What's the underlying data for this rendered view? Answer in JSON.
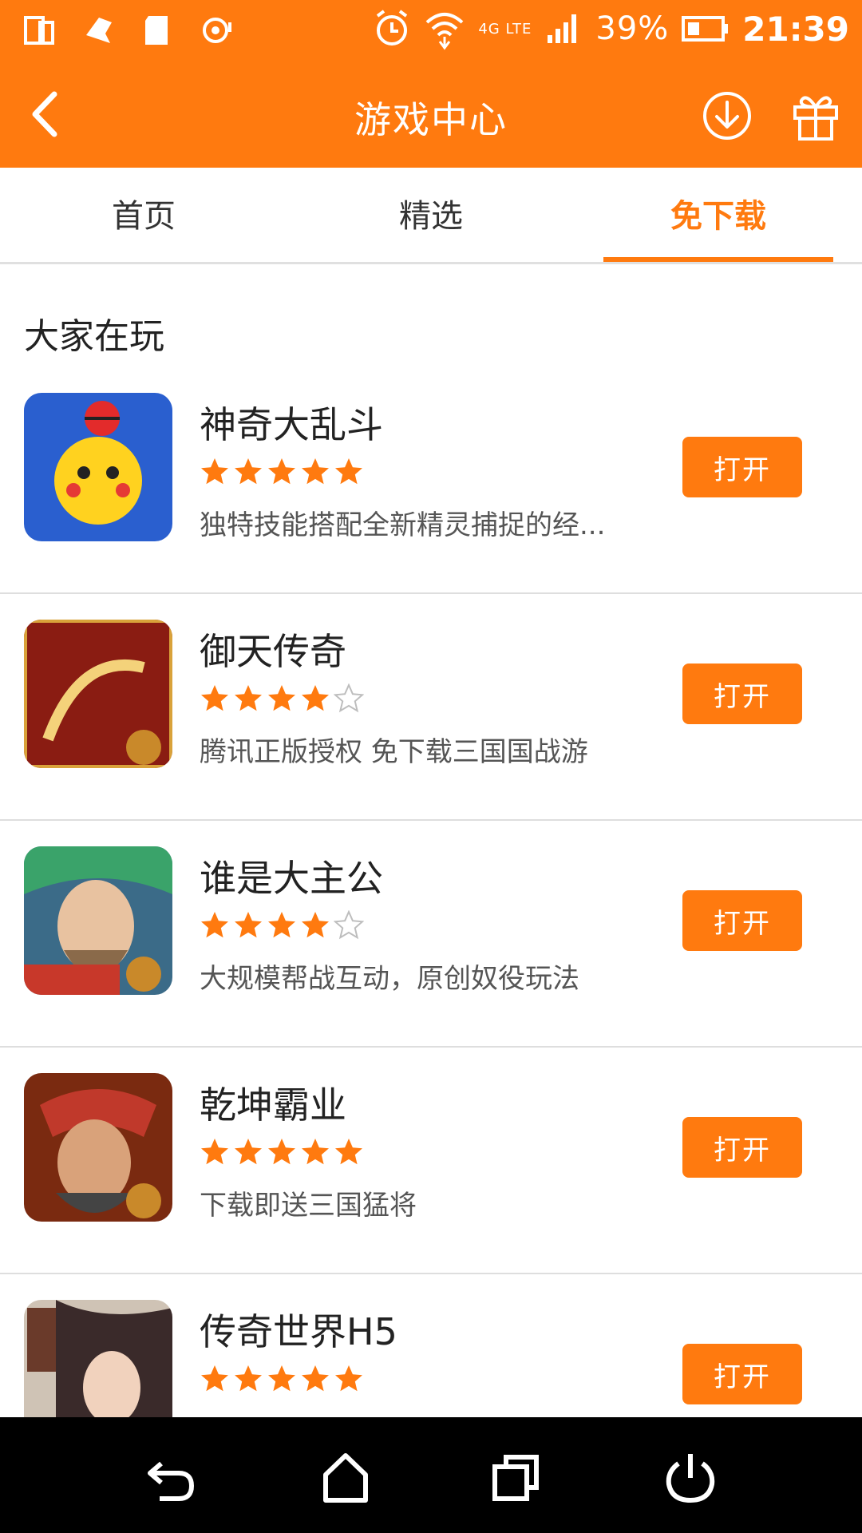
{
  "status_bar": {
    "battery": "39%",
    "time": "21:39",
    "network": "4G LTE",
    "icons": [
      "screen-icon",
      "notification-icon",
      "sd-card-icon",
      "sync-icon",
      "alarm-icon",
      "wifi-icon",
      "signal-icon",
      "battery-icon"
    ]
  },
  "app_bar": {
    "title": "游戏中心",
    "back_icon": "chevron-left-icon",
    "download_icon": "download-icon",
    "gift_icon": "gift-icon"
  },
  "tabs": [
    {
      "label": "首页",
      "active": false
    },
    {
      "label": "精选",
      "active": false
    },
    {
      "label": "免下载",
      "active": true
    }
  ],
  "section": {
    "title": "大家在玩"
  },
  "games": [
    {
      "name": "神奇大乱斗",
      "rating": 5,
      "desc": "独特技能搭配全新精灵捕捉的经...",
      "button": "打开",
      "icon_color": "#2a5fcf"
    },
    {
      "name": "御天传奇",
      "rating": 4,
      "desc": "腾讯正版授权 免下载三国国战游",
      "button": "打开",
      "icon_color": "#8a1c12"
    },
    {
      "name": "谁是大主公",
      "rating": 4,
      "desc": "大规模帮战互动，原创奴役玩法",
      "button": "打开",
      "icon_color": "#3b6b88"
    },
    {
      "name": "乾坤霸业",
      "rating": 5,
      "desc": "下载即送三国猛将",
      "button": "打开",
      "icon_color": "#7a2a10"
    },
    {
      "name": "传奇世界H5",
      "rating": 5,
      "desc": "",
      "button": "打开",
      "icon_color": "#5a4a6a"
    }
  ],
  "colors": {
    "accent": "#ff7a0f",
    "star": "#ff7a0f"
  },
  "nav_bar": {
    "icons": [
      "back-nav-icon",
      "home-icon",
      "recents-icon",
      "power-icon"
    ]
  }
}
